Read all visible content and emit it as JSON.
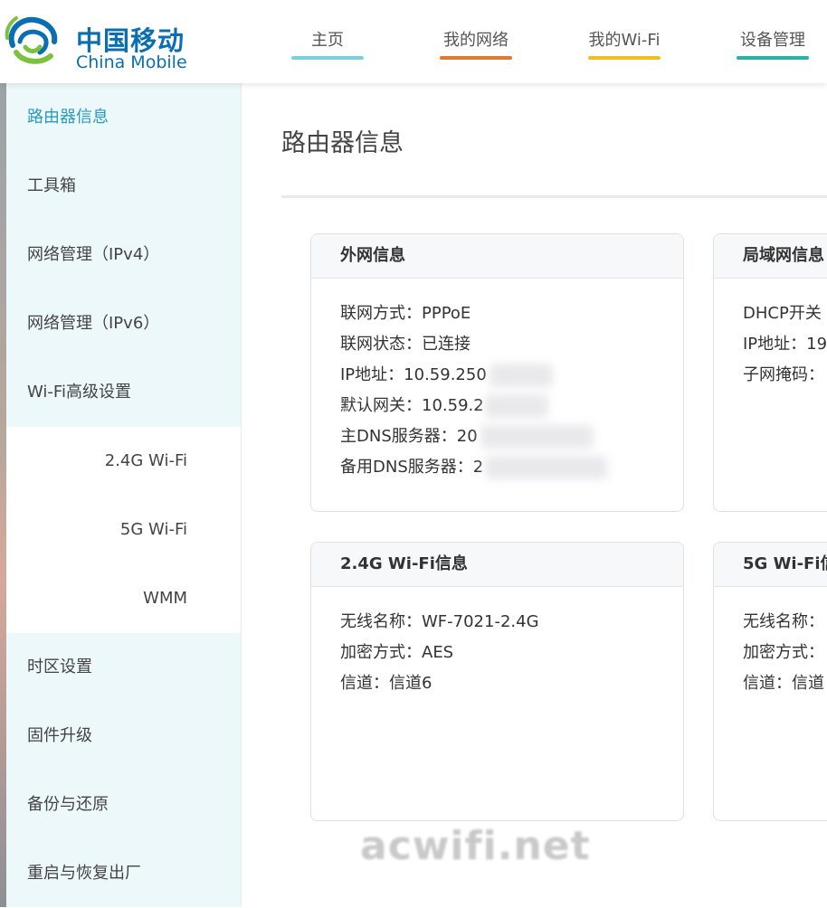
{
  "brand": {
    "name_cn": "中国移动",
    "name_en": "China Mobile",
    "logo_icon": "china-mobile-logo-icon"
  },
  "nav": [
    {
      "label": "主页",
      "color": "#7ccfe0"
    },
    {
      "label": "我的网络",
      "color": "#e07a2e"
    },
    {
      "label": "我的Wi-Fi",
      "color": "#f0c020"
    },
    {
      "label": "设备管理",
      "color": "#27b3a8"
    }
  ],
  "sidebar": {
    "items": [
      {
        "label": "路由器信息",
        "active": true
      },
      {
        "label": "工具箱"
      },
      {
        "label": "网络管理（IPv4）"
      },
      {
        "label": "网络管理（IPv6）"
      },
      {
        "label": "Wi-Fi高级设置"
      },
      {
        "label": "2.4G Wi-Fi",
        "sub": true
      },
      {
        "label": "5G Wi-Fi",
        "sub": true
      },
      {
        "label": "WMM",
        "sub": true
      },
      {
        "label": "时区设置"
      },
      {
        "label": "固件升级"
      },
      {
        "label": "备份与还原"
      },
      {
        "label": "重启与恢复出厂"
      }
    ]
  },
  "page_title": "路由器信息",
  "cards": {
    "wan": {
      "title": "外网信息",
      "rows": [
        "联网方式：PPPoE",
        "联网状态：已连接",
        "IP地址：10.59.250",
        "默认网关：10.59.2",
        "主DNS服务器：20",
        "备用DNS服务器：2"
      ]
    },
    "lan": {
      "title": "局域网信息",
      "rows": [
        "DHCP开关",
        "IP地址：19",
        "子网掩码："
      ]
    },
    "wifi24": {
      "title": "2.4G Wi-Fi信息",
      "rows": [
        "无线名称：WF-7021-2.4G",
        "加密方式：AES",
        "信道：信道6"
      ]
    },
    "wifi5": {
      "title": "5G Wi-Fi信",
      "rows": [
        "无线名称：",
        "加密方式：",
        "信道：信道"
      ]
    }
  },
  "watermark": "acwifi.net"
}
